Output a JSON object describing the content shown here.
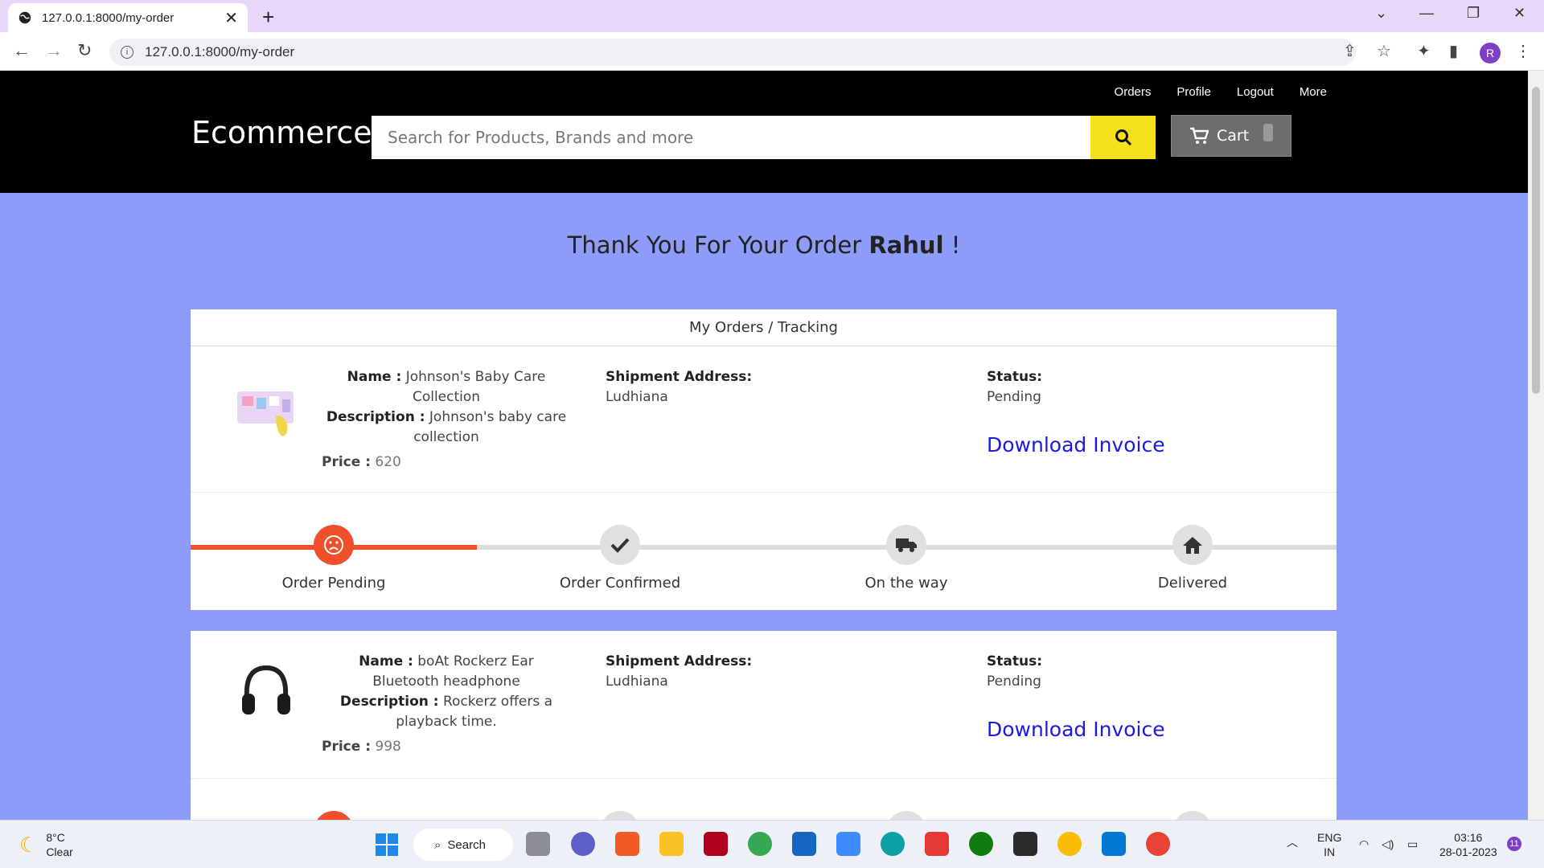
{
  "browser": {
    "tab_title": "127.0.0.1:8000/my-order",
    "url": "127.0.0.1:8000/my-order",
    "profile_initial": "R"
  },
  "site": {
    "brand": "Ecommerce",
    "nav": [
      "Orders",
      "Profile",
      "Logout",
      "More"
    ],
    "search_placeholder": "Search for Products, Brands and more",
    "cart_label": "Cart",
    "accent_yellow": "#f5e11b",
    "accent_orange": "#ef4f2a",
    "page_bg": "#8c9cf8"
  },
  "main": {
    "thanks_prefix": "Thank You For Your Order",
    "user_name": "Rahul",
    "thanks_suffix": "!",
    "card_title": "My Orders / Tracking"
  },
  "labels": {
    "name": "Name :",
    "description": "Description :",
    "price": "Price :",
    "shipment": "Shipment Address:",
    "status": "Status:",
    "invoice": "Download Invoice"
  },
  "orders": [
    {
      "name": "Johnson's Baby Care Collection",
      "description": "Johnson's baby care collection",
      "price": "620",
      "address": "Ludhiana",
      "status": "Pending",
      "image_icon": "baby-care-product-icon",
      "progress_step": 1
    },
    {
      "name": "boAt Rockerz Ear Bluetooth headphone",
      "description": "Rockerz offers a playback time.",
      "price": "998",
      "address": "Ludhiana",
      "status": "Pending",
      "image_icon": "headphone-product-icon",
      "progress_step": 1
    }
  ],
  "tracking_steps": [
    "Order Pending",
    "Order Confirmed",
    "On the way",
    "Delivered"
  ],
  "taskbar": {
    "temp": "8°C",
    "condition": "Clear",
    "search": "Search",
    "lang_top": "ENG",
    "lang_bottom": "IN",
    "time": "03:16",
    "date": "28-01-2023",
    "notifications": "11"
  }
}
